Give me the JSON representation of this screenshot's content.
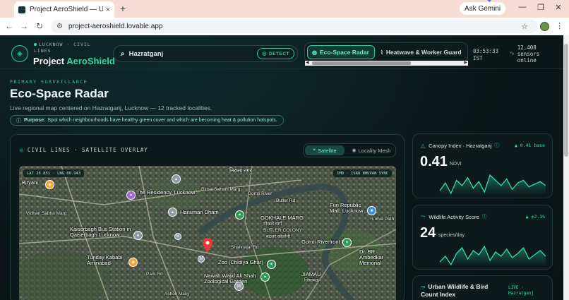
{
  "browser": {
    "tab_title": "Project AeroShield — Urban Cli",
    "tab_close": "×",
    "new_tab": "+",
    "gemini_label": "Ask Gemini",
    "url": "project-aeroshield.lovable.app",
    "controls": {
      "minimize": "—",
      "maximize": "❐",
      "close": "✕"
    },
    "nav": {
      "back": "←",
      "forward": "→",
      "reload": "↻"
    }
  },
  "header": {
    "kicker": "LUCKNOW · CIVIL LINES",
    "brand_main": "Project ",
    "brand_accent": "AeroShield",
    "search_value": "Hazratganj",
    "detect_label": "DETECT",
    "modes": [
      {
        "label": "Eco-Space Radar",
        "active": true,
        "icon": "radar-icon"
      },
      {
        "label": "Heatwave & Worker Guard",
        "active": false,
        "icon": "thermometer-icon"
      }
    ],
    "clock_time": "03:53:33",
    "clock_zone": "IST",
    "sensors_count": "12,408",
    "sensors_label": "sensors online"
  },
  "page": {
    "kicker": "PRIMARY SURVEILLANCE",
    "title": "Eco-Space Radar",
    "subtitle": "Live regional map centered on Hazratganj, Lucknow — 12 tracked localities.",
    "purpose_label": "Purpose:",
    "purpose_text": "Spot which neighbourhoods have healthy green cover and which are becoming heat & pollution hotspots."
  },
  "map_card": {
    "title": "CIVIL LINES · SATELLITE OVERLAY",
    "toggle": [
      {
        "label": "Satellite",
        "active": true
      },
      {
        "label": "Locality Mesh",
        "active": false
      }
    ],
    "coord_badge": "LAT 26.851 · LNG 80.943",
    "source_badge": "IMD · ISRO BHUVAN SYNC",
    "labels": [
      "Biryani",
      "निराला नगर",
      "The Residency, Lucknow",
      "Birbal Sahani Marg",
      "Gomti River",
      "Hanuman Dham",
      "Butler Rd",
      "Fun Republic Mall, Lucknow",
      "GOKHALE MARG",
      "गोखले मार्ग",
      "Kaiserbagh Bus Station in Qaiserbagh Lucknow",
      "BUTLER COLONY",
      "बटलर कॉलोनी",
      "Gomti Riverfront Park",
      "Dr. BR Ambedkar Memorial",
      "Tunday Kababi Aminabad",
      "Zoo (Chidiya Ghar)",
      "Nawab Wajid Ali Shah Zoological Garden",
      "JIAMAU",
      "जियामऊ",
      "Lohia Path",
      "Vidhan Sabha Marg",
      "Shahnajaf Rd",
      "Park Rd",
      "Ashok Marg"
    ]
  },
  "metrics": {
    "canopy": {
      "title": "Canopy Index · Hazratganj",
      "delta": "▲ 0.41 base",
      "value": "0.41",
      "unit": "NDVI",
      "trend": [
        12,
        18,
        10,
        20,
        16,
        22,
        14,
        19,
        11,
        24,
        20,
        16,
        21,
        13,
        18,
        20,
        15,
        17,
        19,
        16
      ]
    },
    "wildlife": {
      "title": "Wildlife Activity Score",
      "delta": "▲ ±2.1%",
      "value": "24",
      "unit": "species/day",
      "trend": [
        14,
        18,
        12,
        20,
        24,
        16,
        22,
        19,
        25,
        15,
        21,
        18,
        23,
        17,
        20,
        24,
        16,
        19,
        22,
        18
      ]
    },
    "live_card": {
      "title": "Urban Wildlife & Bird Count Index",
      "badge_top": "LIVE ·",
      "badge_bottom": "Hazratganj"
    }
  },
  "colors": {
    "accent": "#2fc9a3",
    "accent_bright": "#2fe0a8",
    "background": "#0b1a1c",
    "map_pin_red": "#e53935"
  }
}
